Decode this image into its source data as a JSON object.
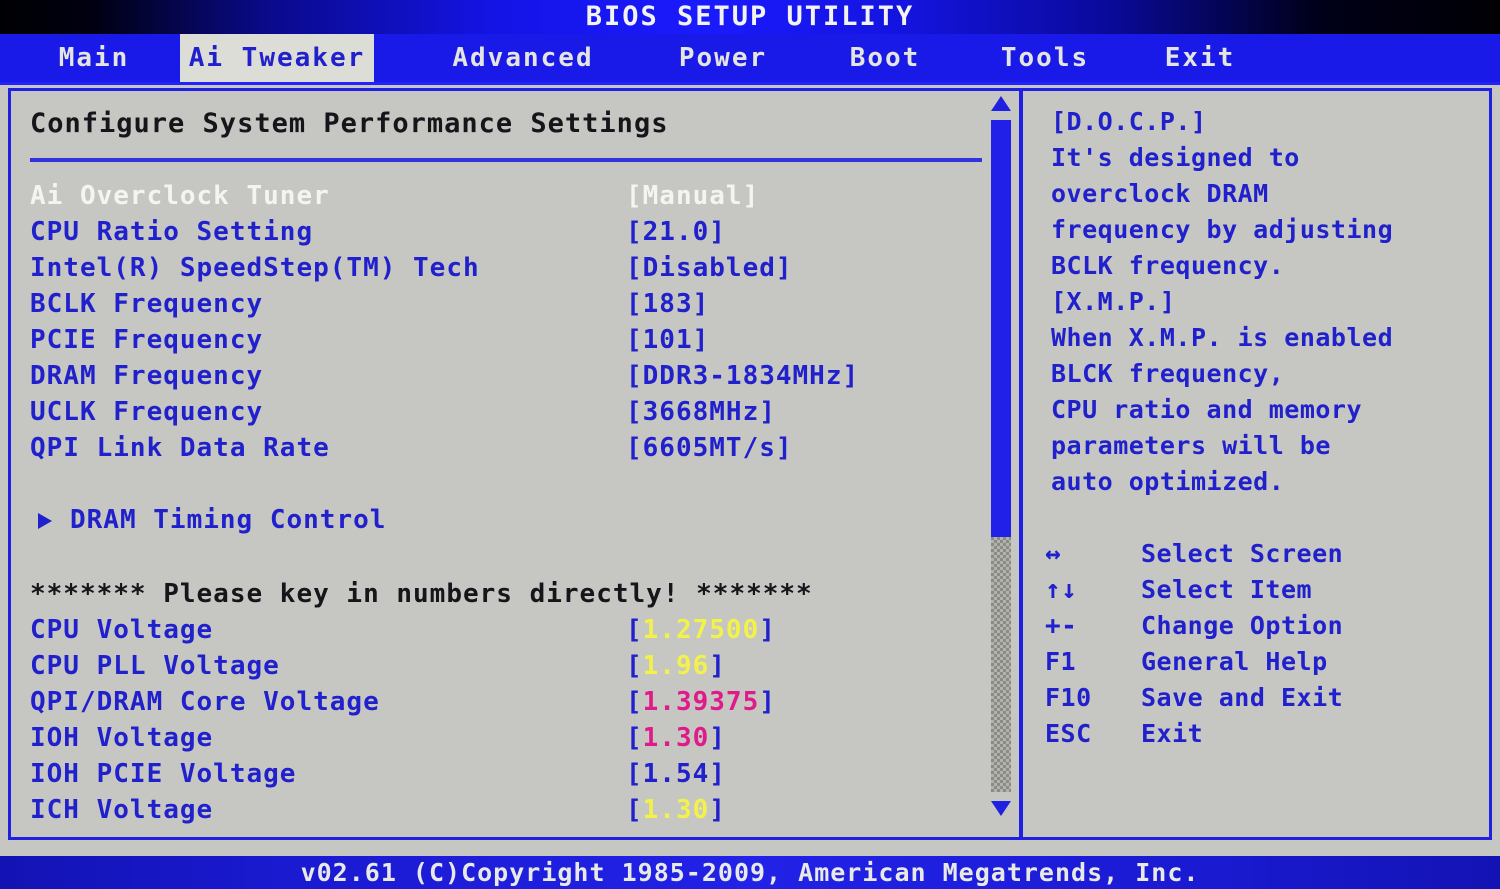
{
  "window": {
    "title": "BIOS SETUP UTILITY"
  },
  "colors": {
    "title_bar_blue": "#1a1aff",
    "tab_bar_blue": "#1a1ae8",
    "screen_bg": "#c6c6c2",
    "text_blue": "#2020cc",
    "selected_white": "#f4f4f0",
    "value_yellow": "#f2f24a",
    "value_magenta": "#e01a8a",
    "heading_black": "#15151a"
  },
  "tabs": [
    {
      "label": "Main",
      "active": false
    },
    {
      "label": "Ai Tweaker",
      "active": true
    },
    {
      "label": "Advanced",
      "active": false
    },
    {
      "label": "Power",
      "active": false
    },
    {
      "label": "Boot",
      "active": false
    },
    {
      "label": "Tools",
      "active": false
    },
    {
      "label": "Exit",
      "active": false
    }
  ],
  "main": {
    "heading": "Configure System Performance Settings",
    "settings": [
      {
        "label": "Ai Overclock Tuner",
        "value": "[Manual]",
        "selected": true
      },
      {
        "label": "CPU Ratio Setting",
        "value": "[21.0]",
        "selected": false
      },
      {
        "label": "Intel(R) SpeedStep(TM) Tech",
        "value": "[Disabled]",
        "selected": false
      },
      {
        "label": "BCLK Frequency",
        "value": "[183]",
        "selected": false
      },
      {
        "label": "PCIE Frequency",
        "value": "[101]",
        "selected": false
      },
      {
        "label": "DRAM Frequency",
        "value": "[DDR3-1834MHz]",
        "selected": false
      },
      {
        "label": "UCLK Frequency",
        "value": "[3668MHz]",
        "selected": false
      },
      {
        "label": "QPI Link Data Rate",
        "value": "[6605MT/s]",
        "selected": false
      }
    ],
    "submenu": {
      "label": "DRAM Timing Control",
      "arrow": "right-triangle-icon"
    },
    "notice": "******* Please key in numbers directly! *******",
    "voltages": [
      {
        "label": "CPU Voltage",
        "open": "[",
        "num": "1.27500",
        "close": "]",
        "color": "yellow"
      },
      {
        "label": "CPU PLL Voltage",
        "open": "[",
        "num": "1.96",
        "close": "]",
        "color": "yellow"
      },
      {
        "label": "QPI/DRAM Core Voltage",
        "open": "[",
        "num": "1.39375",
        "close": "]",
        "color": "magenta"
      },
      {
        "label": "IOH Voltage",
        "open": "[",
        "num": "1.30",
        "close": "]",
        "color": "magenta"
      },
      {
        "label": "IOH PCIE Voltage",
        "open": "[",
        "num": "1.54",
        "close": "]",
        "color": "blue"
      },
      {
        "label": "ICH Voltage",
        "open": "[",
        "num": "1.30",
        "close": "]",
        "color": "yellow"
      }
    ]
  },
  "scrollbar": {
    "up_arrow": "scroll-up-arrow-icon",
    "down_arrow": "scroll-down-arrow-icon",
    "thumb_position_percent": 0,
    "thumb_size_percent": 62
  },
  "help": {
    "lines": [
      "[D.O.C.P.]",
      "It's designed to",
      "overclock DRAM",
      "frequency by adjusting",
      "BCLK frequency.",
      "[X.M.P.]",
      "When X.M.P. is enabled",
      "BLCK frequency,",
      "CPU ratio and memory",
      "parameters will be",
      "auto optimized."
    ],
    "keys": [
      {
        "key": "↔",
        "desc": "Select Screen",
        "icon": "left-right-arrow-icon"
      },
      {
        "key": "↑↓",
        "desc": "Select Item",
        "icon": "up-down-arrow-icon"
      },
      {
        "key": "+-",
        "desc": "Change Option",
        "icon": "plus-minus-icon"
      },
      {
        "key": "F1",
        "desc": "General Help",
        "icon": ""
      },
      {
        "key": "F10",
        "desc": "Save and Exit",
        "icon": ""
      },
      {
        "key": "ESC",
        "desc": "Exit",
        "icon": ""
      }
    ]
  },
  "footer": {
    "text": "v02.61 (C)Copyright 1985-2009, American Megatrends, Inc."
  }
}
